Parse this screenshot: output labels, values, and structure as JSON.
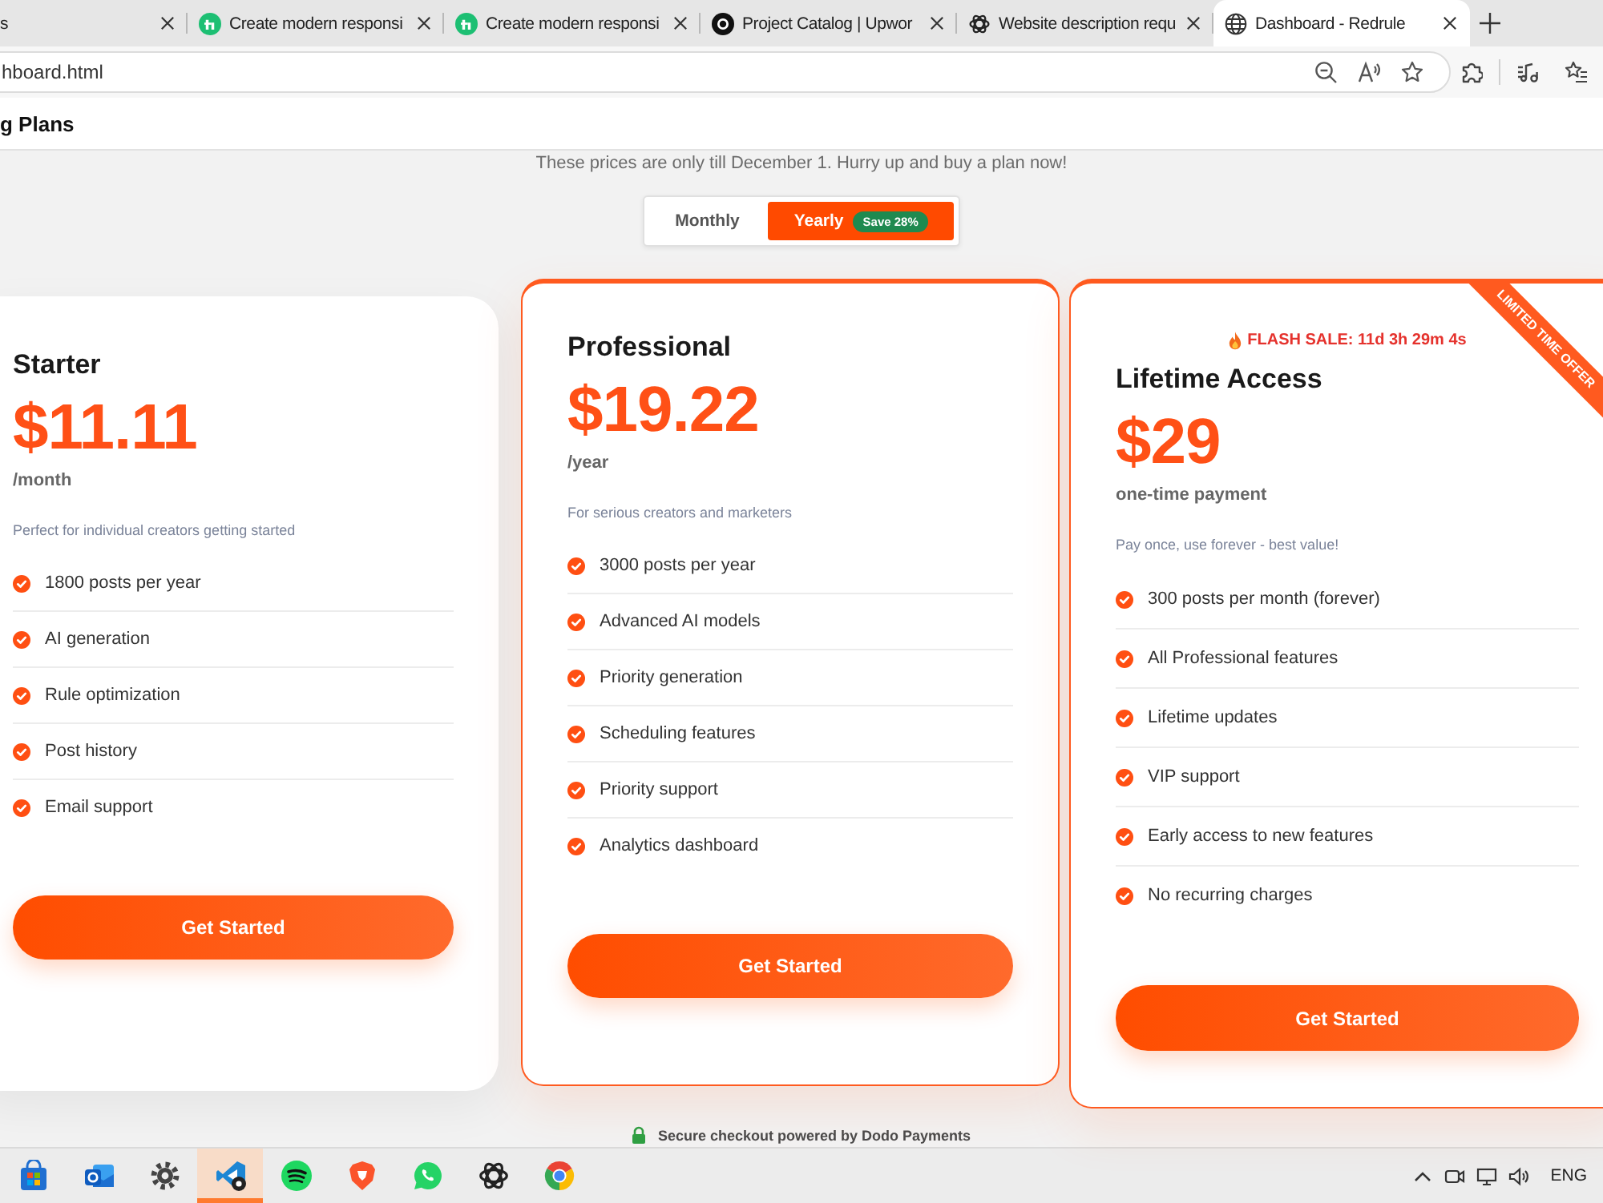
{
  "browser": {
    "tabs": [
      {
        "title": "s",
        "kind": "blank",
        "selected": false
      },
      {
        "title": "Create modern responsi",
        "kind": "badge",
        "selected": false
      },
      {
        "title": "Create modern responsi",
        "kind": "badge",
        "selected": false
      },
      {
        "title": "Project Catalog | Upwor",
        "kind": "disc",
        "selected": false
      },
      {
        "title": "Website description requ",
        "kind": "knot",
        "selected": false
      },
      {
        "title": "Dashboard - Redrule",
        "kind": "globe",
        "selected": true
      }
    ],
    "address": "hboard.html"
  },
  "header": {
    "title": "g Plans"
  },
  "subtitle": "These prices are only till December 1. Hurry up and buy a plan now!",
  "billing_toggle": [
    {
      "label": "Monthly",
      "selected": false
    },
    {
      "label": "Yearly",
      "selected": true,
      "badge": "Save 28%"
    }
  ],
  "plans": [
    {
      "name": "Starter",
      "featured": false,
      "price": "$11.11",
      "period": "/month",
      "description": "Perfect for individual creators getting started",
      "features": [
        "1800 posts per year",
        "AI generation",
        "Rule optimization",
        "Post history",
        "Email support"
      ],
      "button": "Get Started"
    },
    {
      "name": "Professional",
      "featured": true,
      "price": "$19.22",
      "period": "/year",
      "description": "For serious creators and marketers",
      "features": [
        "3000 posts per year",
        "Advanced AI models",
        "Priority generation",
        "Scheduling features",
        "Priority support",
        "Analytics dashboard"
      ],
      "button": "Get Started"
    },
    {
      "name": "Lifetime Access",
      "featured": true,
      "flash_sale": "FLASH SALE: 11d 3h 29m 4s",
      "ribbon": "LIMITED TIME OFFER",
      "price": "$29",
      "period": "one-time payment",
      "description": "Pay once, use forever - best value!",
      "features": [
        "300 posts per month (forever)",
        "All Professional features",
        "Lifetime updates",
        "VIP support",
        "Early access to new features",
        "No recurring charges"
      ],
      "button": "Get Started"
    }
  ],
  "footer": {
    "note": "Secure checkout powered by Dodo Payments"
  },
  "taskbar": {
    "apps": [
      {
        "kind": "store",
        "selected": false
      },
      {
        "kind": "mail",
        "selected": false
      },
      {
        "kind": "gear",
        "selected": false
      },
      {
        "kind": "code",
        "selected": true
      },
      {
        "kind": "waves",
        "selected": false
      },
      {
        "kind": "shield",
        "selected": false
      },
      {
        "kind": "chat",
        "selected": false
      },
      {
        "kind": "knot",
        "selected": false
      },
      {
        "kind": "ring",
        "selected": false
      }
    ],
    "language": "ENG"
  }
}
